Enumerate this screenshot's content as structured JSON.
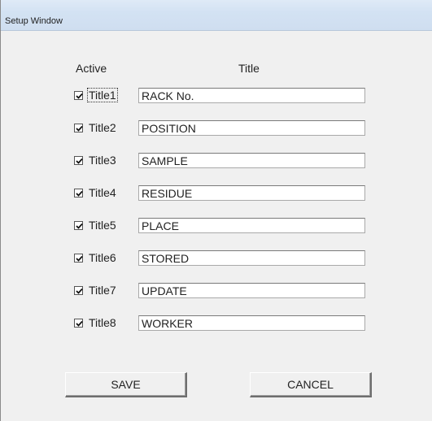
{
  "window": {
    "title": "Setup Window"
  },
  "headers": {
    "active": "Active",
    "title": "Title"
  },
  "rows": [
    {
      "label": "Title1",
      "checked": true,
      "value": "RACK No."
    },
    {
      "label": "Title2",
      "checked": true,
      "value": "POSITION"
    },
    {
      "label": "Title3",
      "checked": true,
      "value": "SAMPLE"
    },
    {
      "label": "Title4",
      "checked": true,
      "value": "RESIDUE"
    },
    {
      "label": "Title5",
      "checked": true,
      "value": "PLACE"
    },
    {
      "label": "Title6",
      "checked": true,
      "value": "STORED"
    },
    {
      "label": "Title7",
      "checked": true,
      "value": "UPDATE"
    },
    {
      "label": "Title8",
      "checked": true,
      "value": "WORKER"
    }
  ],
  "buttons": {
    "save_label": "SAVE",
    "cancel_label": "CANCEL"
  },
  "icons": {
    "checkbox_checked": "checkmark-icon"
  },
  "colors": {
    "window_background": "#f0f0f0",
    "titlebar_background": "#d3e2f3"
  }
}
